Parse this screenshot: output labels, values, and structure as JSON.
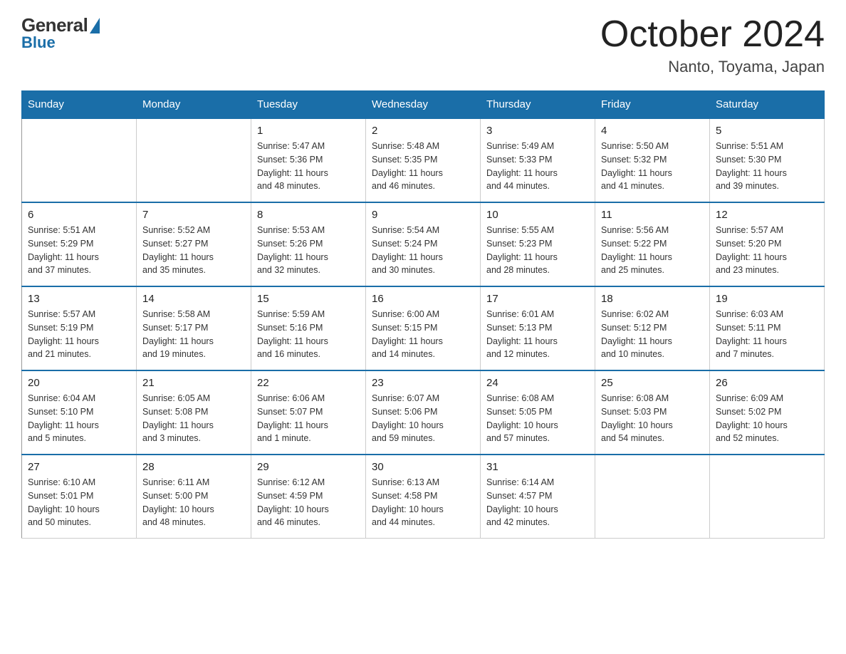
{
  "logo": {
    "general": "General",
    "blue": "Blue"
  },
  "title": "October 2024",
  "subtitle": "Nanto, Toyama, Japan",
  "headers": [
    "Sunday",
    "Monday",
    "Tuesday",
    "Wednesday",
    "Thursday",
    "Friday",
    "Saturday"
  ],
  "weeks": [
    [
      {
        "day": "",
        "info": ""
      },
      {
        "day": "",
        "info": ""
      },
      {
        "day": "1",
        "info": "Sunrise: 5:47 AM\nSunset: 5:36 PM\nDaylight: 11 hours\nand 48 minutes."
      },
      {
        "day": "2",
        "info": "Sunrise: 5:48 AM\nSunset: 5:35 PM\nDaylight: 11 hours\nand 46 minutes."
      },
      {
        "day": "3",
        "info": "Sunrise: 5:49 AM\nSunset: 5:33 PM\nDaylight: 11 hours\nand 44 minutes."
      },
      {
        "day": "4",
        "info": "Sunrise: 5:50 AM\nSunset: 5:32 PM\nDaylight: 11 hours\nand 41 minutes."
      },
      {
        "day": "5",
        "info": "Sunrise: 5:51 AM\nSunset: 5:30 PM\nDaylight: 11 hours\nand 39 minutes."
      }
    ],
    [
      {
        "day": "6",
        "info": "Sunrise: 5:51 AM\nSunset: 5:29 PM\nDaylight: 11 hours\nand 37 minutes."
      },
      {
        "day": "7",
        "info": "Sunrise: 5:52 AM\nSunset: 5:27 PM\nDaylight: 11 hours\nand 35 minutes."
      },
      {
        "day": "8",
        "info": "Sunrise: 5:53 AM\nSunset: 5:26 PM\nDaylight: 11 hours\nand 32 minutes."
      },
      {
        "day": "9",
        "info": "Sunrise: 5:54 AM\nSunset: 5:24 PM\nDaylight: 11 hours\nand 30 minutes."
      },
      {
        "day": "10",
        "info": "Sunrise: 5:55 AM\nSunset: 5:23 PM\nDaylight: 11 hours\nand 28 minutes."
      },
      {
        "day": "11",
        "info": "Sunrise: 5:56 AM\nSunset: 5:22 PM\nDaylight: 11 hours\nand 25 minutes."
      },
      {
        "day": "12",
        "info": "Sunrise: 5:57 AM\nSunset: 5:20 PM\nDaylight: 11 hours\nand 23 minutes."
      }
    ],
    [
      {
        "day": "13",
        "info": "Sunrise: 5:57 AM\nSunset: 5:19 PM\nDaylight: 11 hours\nand 21 minutes."
      },
      {
        "day": "14",
        "info": "Sunrise: 5:58 AM\nSunset: 5:17 PM\nDaylight: 11 hours\nand 19 minutes."
      },
      {
        "day": "15",
        "info": "Sunrise: 5:59 AM\nSunset: 5:16 PM\nDaylight: 11 hours\nand 16 minutes."
      },
      {
        "day": "16",
        "info": "Sunrise: 6:00 AM\nSunset: 5:15 PM\nDaylight: 11 hours\nand 14 minutes."
      },
      {
        "day": "17",
        "info": "Sunrise: 6:01 AM\nSunset: 5:13 PM\nDaylight: 11 hours\nand 12 minutes."
      },
      {
        "day": "18",
        "info": "Sunrise: 6:02 AM\nSunset: 5:12 PM\nDaylight: 11 hours\nand 10 minutes."
      },
      {
        "day": "19",
        "info": "Sunrise: 6:03 AM\nSunset: 5:11 PM\nDaylight: 11 hours\nand 7 minutes."
      }
    ],
    [
      {
        "day": "20",
        "info": "Sunrise: 6:04 AM\nSunset: 5:10 PM\nDaylight: 11 hours\nand 5 minutes."
      },
      {
        "day": "21",
        "info": "Sunrise: 6:05 AM\nSunset: 5:08 PM\nDaylight: 11 hours\nand 3 minutes."
      },
      {
        "day": "22",
        "info": "Sunrise: 6:06 AM\nSunset: 5:07 PM\nDaylight: 11 hours\nand 1 minute."
      },
      {
        "day": "23",
        "info": "Sunrise: 6:07 AM\nSunset: 5:06 PM\nDaylight: 10 hours\nand 59 minutes."
      },
      {
        "day": "24",
        "info": "Sunrise: 6:08 AM\nSunset: 5:05 PM\nDaylight: 10 hours\nand 57 minutes."
      },
      {
        "day": "25",
        "info": "Sunrise: 6:08 AM\nSunset: 5:03 PM\nDaylight: 10 hours\nand 54 minutes."
      },
      {
        "day": "26",
        "info": "Sunrise: 6:09 AM\nSunset: 5:02 PM\nDaylight: 10 hours\nand 52 minutes."
      }
    ],
    [
      {
        "day": "27",
        "info": "Sunrise: 6:10 AM\nSunset: 5:01 PM\nDaylight: 10 hours\nand 50 minutes."
      },
      {
        "day": "28",
        "info": "Sunrise: 6:11 AM\nSunset: 5:00 PM\nDaylight: 10 hours\nand 48 minutes."
      },
      {
        "day": "29",
        "info": "Sunrise: 6:12 AM\nSunset: 4:59 PM\nDaylight: 10 hours\nand 46 minutes."
      },
      {
        "day": "30",
        "info": "Sunrise: 6:13 AM\nSunset: 4:58 PM\nDaylight: 10 hours\nand 44 minutes."
      },
      {
        "day": "31",
        "info": "Sunrise: 6:14 AM\nSunset: 4:57 PM\nDaylight: 10 hours\nand 42 minutes."
      },
      {
        "day": "",
        "info": ""
      },
      {
        "day": "",
        "info": ""
      }
    ]
  ]
}
